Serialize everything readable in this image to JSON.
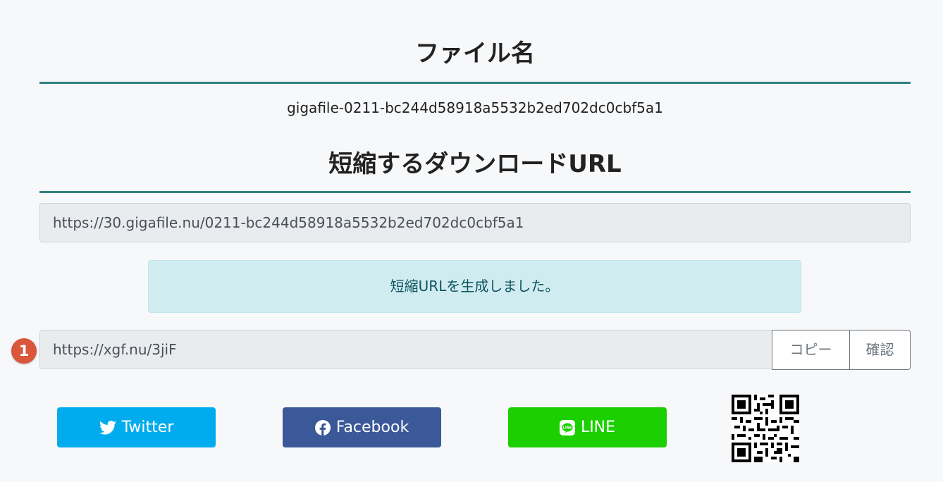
{
  "file_section": {
    "heading": "ファイル名",
    "filename": "gigafile-0211-bc244d58918a5532b2ed702dc0cbf5a1"
  },
  "url_section": {
    "heading": "短縮するダウンロードURL",
    "long_url": "https://30.gigafile.nu/0211-bc244d58918a5532b2ed702dc0cbf5a1",
    "alert": "短縮URLを生成しました。",
    "badge": "1",
    "short_url": "https://xgf.nu/3jiF",
    "copy_label": "コピー",
    "confirm_label": "確認"
  },
  "share": {
    "twitter_label": "Twitter",
    "facebook_label": "Facebook",
    "line_label": "LINE",
    "twitter_color": "#00acee",
    "facebook_color": "#3b5998",
    "line_color": "#1ccf00"
  },
  "icons": [
    "twitter-icon",
    "facebook-icon",
    "line-icon",
    "qr-code-icon"
  ]
}
